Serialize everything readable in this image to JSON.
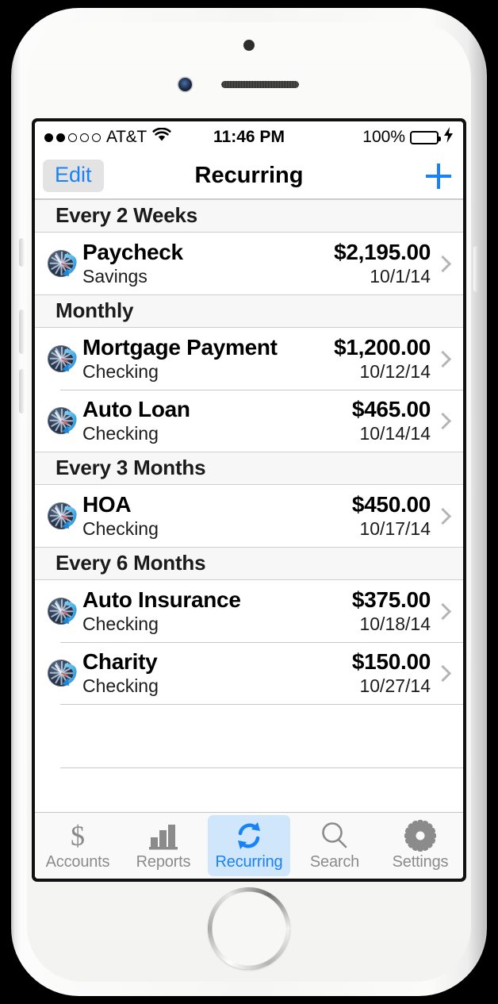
{
  "status_bar": {
    "signal_dots_filled": 2,
    "signal_dots_total": 5,
    "carrier": "AT&T",
    "wifi_icon": "wifi-icon",
    "time": "11:46 PM",
    "battery_percent": "100%",
    "battery_level": 100,
    "charging": true
  },
  "nav": {
    "edit_label": "Edit",
    "title": "Recurring",
    "add_icon": "plus-icon"
  },
  "colors": {
    "accent_blue": "#1a82f7",
    "tab_selected_bg": "#cfe6fb",
    "battery_green": "#4cd657",
    "section_header_bg": "#f7f7f7"
  },
  "sections": [
    {
      "header": "Every 2 Weeks",
      "rows": [
        {
          "icon": "recurring-clock-icon",
          "title": "Paycheck",
          "account": "Savings",
          "amount": "$2,195.00",
          "date": "10/1/14"
        }
      ]
    },
    {
      "header": "Monthly",
      "rows": [
        {
          "icon": "recurring-clock-icon",
          "title": "Mortgage Payment",
          "account": "Checking",
          "amount": "$1,200.00",
          "date": "10/12/14"
        },
        {
          "icon": "recurring-clock-icon",
          "title": "Auto Loan",
          "account": "Checking",
          "amount": "$465.00",
          "date": "10/14/14"
        }
      ]
    },
    {
      "header": "Every 3 Months",
      "rows": [
        {
          "icon": "recurring-clock-icon",
          "title": "HOA",
          "account": "Checking",
          "amount": "$450.00",
          "date": "10/17/14"
        }
      ]
    },
    {
      "header": "Every 6 Months",
      "rows": [
        {
          "icon": "recurring-clock-icon",
          "title": "Auto Insurance",
          "account": "Checking",
          "amount": "$375.00",
          "date": "10/18/14"
        },
        {
          "icon": "recurring-clock-icon",
          "title": "Charity",
          "account": "Checking",
          "amount": "$150.00",
          "date": "10/27/14"
        }
      ]
    }
  ],
  "empty_filler_rows": 2,
  "tabs": [
    {
      "label": "Accounts",
      "icon": "dollar-sign-icon",
      "active": false
    },
    {
      "label": "Reports",
      "icon": "bar-chart-icon",
      "active": false
    },
    {
      "label": "Recurring",
      "icon": "refresh-cycle-icon",
      "active": true
    },
    {
      "label": "Search",
      "icon": "search-icon",
      "active": false
    },
    {
      "label": "Settings",
      "icon": "gear-icon",
      "active": false
    }
  ]
}
